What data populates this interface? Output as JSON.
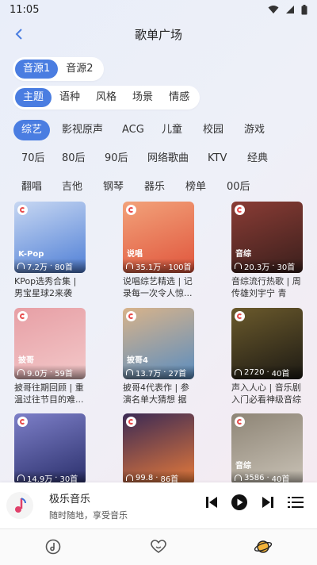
{
  "status": {
    "time": "11:05"
  },
  "header": {
    "title": "歌单广场"
  },
  "sources": [
    {
      "label": "音源1",
      "active": true
    },
    {
      "label": "音源2",
      "active": false
    }
  ],
  "tabs": [
    {
      "label": "主题",
      "active": true
    },
    {
      "label": "语种"
    },
    {
      "label": "风格"
    },
    {
      "label": "场景"
    },
    {
      "label": "情感"
    }
  ],
  "tags": {
    "row1": [
      "综艺",
      "影视原声",
      "ACG",
      "儿童",
      "校园",
      "游戏"
    ],
    "row2": [
      "70后",
      "80后",
      "90后",
      "网络歌曲",
      "KTV",
      "经典"
    ],
    "row3": [
      "翻唱",
      "吉他",
      "钢琴",
      "器乐",
      "榜单",
      "00后"
    ]
  },
  "playlists": [
    {
      "cat": "K-Pop",
      "plays": "7.2万",
      "count": "80首",
      "title": "KPop选秀合集 | 男宝星球2来袭 下...",
      "c1": "#4f7fd6",
      "c2": "#c7d7f2"
    },
    {
      "cat": "说唱",
      "plays": "35.1万",
      "count": "100首",
      "title": "说唱综艺精选 | 记录每一次令人惊...",
      "c1": "#e0553c",
      "c2": "#f2a27a"
    },
    {
      "cat": "音综",
      "plays": "20.3万",
      "count": "30首",
      "title": "音综流行热歌 | 周传雄刘宇宁 青花...",
      "c1": "#3a1f1c",
      "c2": "#8a3c35"
    },
    {
      "cat": "披哥",
      "plays": "9.0万",
      "count": "59首",
      "title": "披哥往期回顾 | 重温过往节目的难...",
      "c1": "#f3c8c9",
      "c2": "#e79fa5"
    },
    {
      "cat": "披哥4",
      "plays": "13.7万",
      "count": "27首",
      "title": "披哥4代表作 | 参演名单大猜想 据传...",
      "c1": "#5a8dc0",
      "c2": "#d8b38a"
    },
    {
      "cat": "",
      "plays": "2720",
      "count": "40首",
      "title": "声入人心 | 音乐剧入门必看神级音综",
      "c1": "#1d1a14",
      "c2": "#6b5a2c"
    },
    {
      "cat": "",
      "plays": "14.9万",
      "count": "30首",
      "title": "",
      "c1": "#2a2f6b",
      "c2": "#7d7fc8"
    },
    {
      "cat": "",
      "plays": "99.8",
      "count": "86首",
      "title": "",
      "c1": "#e67a3a",
      "c2": "#3b2a55"
    },
    {
      "cat": "音综",
      "plays": "3586",
      "count": "40首",
      "title": "",
      "c1": "#c9c2b6",
      "c2": "#8e8576"
    }
  ],
  "player": {
    "title": "极乐音乐",
    "subtitle": "随时随地，享受音乐"
  },
  "colors": {
    "accent": "#4a7de1"
  }
}
